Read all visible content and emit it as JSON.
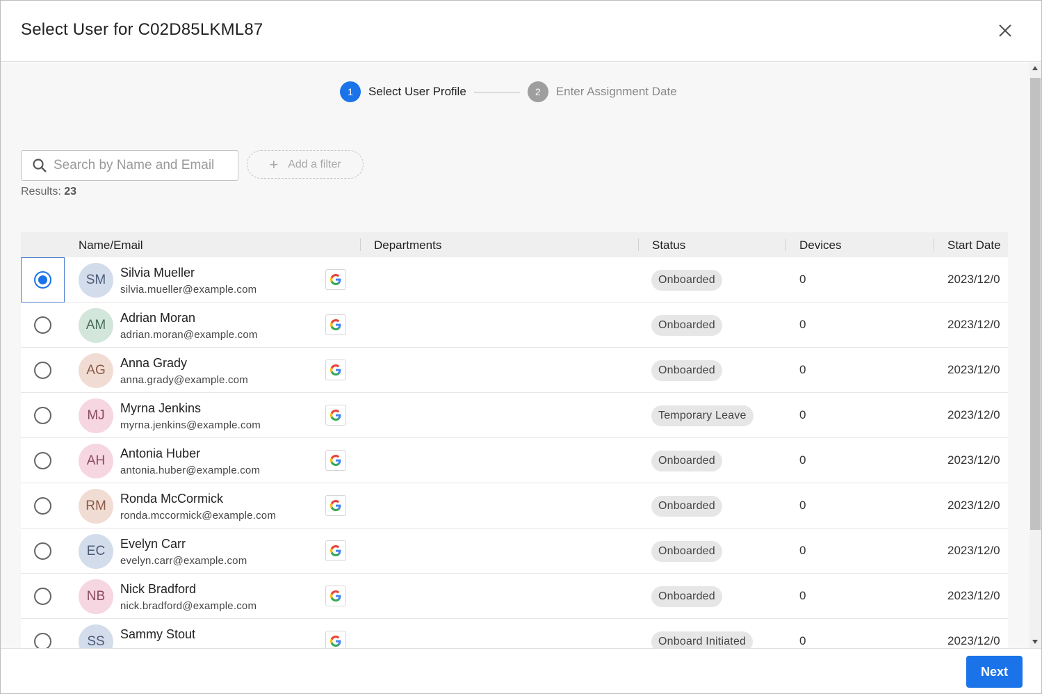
{
  "dialog": {
    "title": "Select User for C02D85LKML87"
  },
  "stepper": {
    "steps": [
      {
        "number": "1",
        "label": "Select User Profile"
      },
      {
        "number": "2",
        "label": "Enter Assignment Date"
      }
    ]
  },
  "search": {
    "placeholder": "Search by Name and Email",
    "value": ""
  },
  "filter": {
    "label": "Add a filter"
  },
  "results": {
    "label": "Results:",
    "count": "23"
  },
  "table": {
    "headers": {
      "name": "Name/Email",
      "departments": "Departments",
      "status": "Status",
      "devices": "Devices",
      "start_date": "Start Date"
    },
    "rows": [
      {
        "initials": "SM",
        "name": "Silvia Mueller",
        "email": "silvia.mueller@example.com",
        "status": "Onboarded",
        "devices": "0",
        "start_date": "2023/12/0",
        "selected": true,
        "avatar_bg": "#d3dcea",
        "avatar_fg": "#4a5a78"
      },
      {
        "initials": "AM",
        "name": "Adrian Moran",
        "email": "adrian.moran@example.com",
        "status": "Onboarded",
        "devices": "0",
        "start_date": "2023/12/0",
        "selected": false,
        "avatar_bg": "#d3e6dc",
        "avatar_fg": "#4a6d5a"
      },
      {
        "initials": "AG",
        "name": "Anna Grady",
        "email": "anna.grady@example.com",
        "status": "Onboarded",
        "devices": "0",
        "start_date": "2023/12/0",
        "selected": false,
        "avatar_bg": "#f1dcd3",
        "avatar_fg": "#8a5a48"
      },
      {
        "initials": "MJ",
        "name": "Myrna Jenkins",
        "email": "myrna.jenkins@example.com",
        "status": "Temporary Leave",
        "devices": "0",
        "start_date": "2023/12/0",
        "selected": false,
        "avatar_bg": "#f6d6e0",
        "avatar_fg": "#8a4a60"
      },
      {
        "initials": "AH",
        "name": "Antonia Huber",
        "email": "antonia.huber@example.com",
        "status": "Onboarded",
        "devices": "0",
        "start_date": "2023/12/0",
        "selected": false,
        "avatar_bg": "#f6d6e0",
        "avatar_fg": "#8a4a60"
      },
      {
        "initials": "RM",
        "name": "Ronda McCormick",
        "email": "ronda.mccormick@example.com",
        "status": "Onboarded",
        "devices": "0",
        "start_date": "2023/12/0",
        "selected": false,
        "avatar_bg": "#f1dcd3",
        "avatar_fg": "#8a5a48"
      },
      {
        "initials": "EC",
        "name": "Evelyn Carr",
        "email": "evelyn.carr@example.com",
        "status": "Onboarded",
        "devices": "0",
        "start_date": "2023/12/0",
        "selected": false,
        "avatar_bg": "#d3dcea",
        "avatar_fg": "#4a5a78"
      },
      {
        "initials": "NB",
        "name": "Nick Bradford",
        "email": "nick.bradford@example.com",
        "status": "Onboarded",
        "devices": "0",
        "start_date": "2023/12/0",
        "selected": false,
        "avatar_bg": "#f6d6e0",
        "avatar_fg": "#8a4a60"
      },
      {
        "initials": "SS",
        "name": "Sammy Stout",
        "email": "",
        "status": "Onboard Initiated",
        "devices": "0",
        "start_date": "2023/12/0",
        "selected": false,
        "avatar_bg": "#d3dcea",
        "avatar_fg": "#4a5a78"
      }
    ]
  },
  "footer": {
    "next_label": "Next"
  },
  "colors": {
    "primary": "#1a73e8",
    "inactive_step": "#9e9e9e",
    "status_bg": "#e6e6e6"
  },
  "icons": {
    "close": "close-icon",
    "search": "search-icon",
    "add": "plus-icon",
    "provider": "google-icon"
  }
}
